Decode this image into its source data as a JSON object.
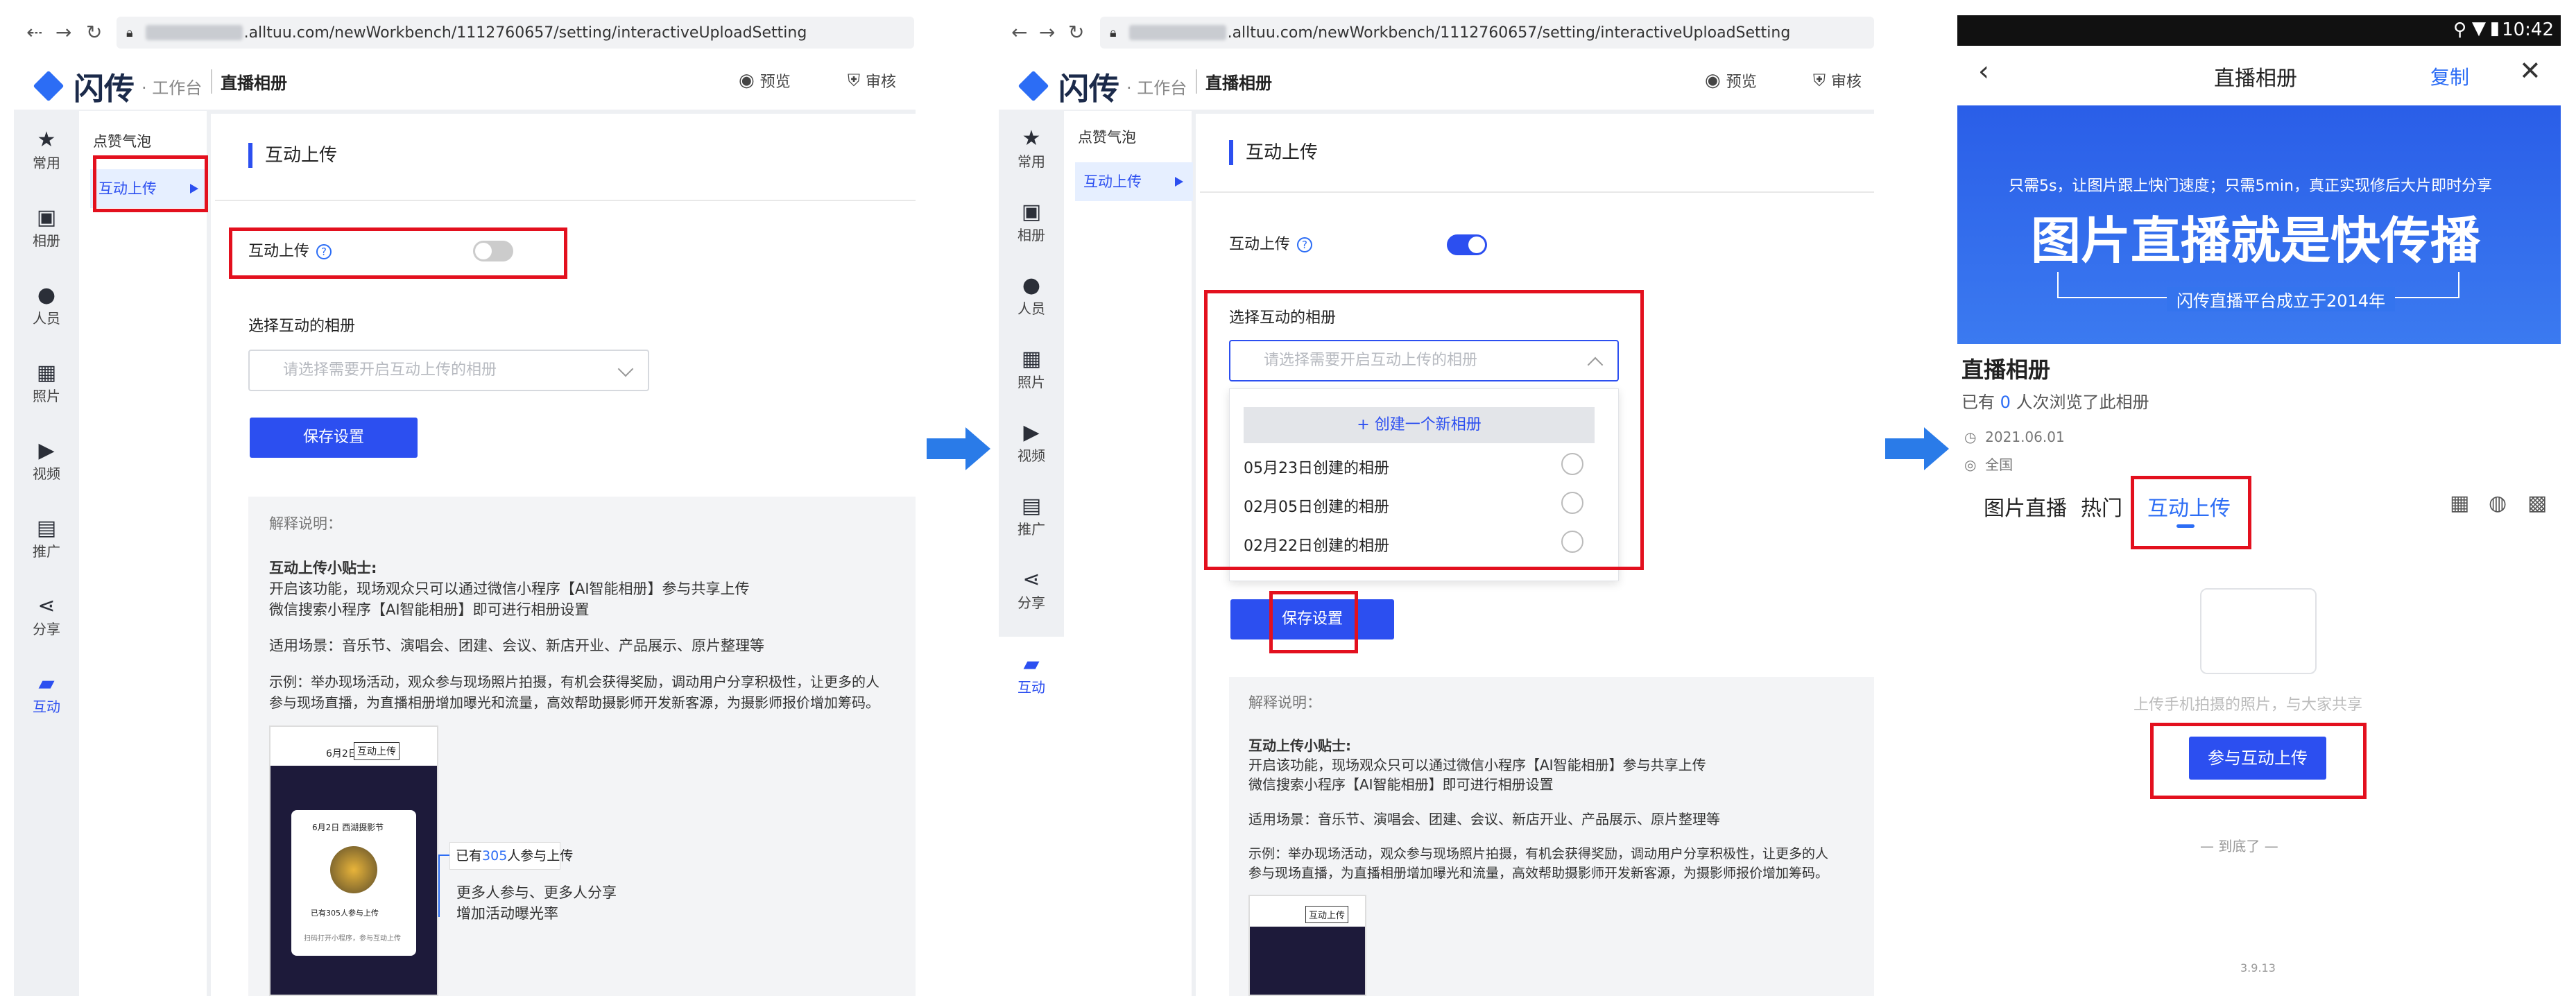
{
  "url_suffix": ".alltuu.com/newWorkbench/1112760657/setting/interactiveUploadSetting",
  "logo_text": "闪传",
  "workbench_label": "· 工作台",
  "app_title": "直播相册",
  "header": {
    "preview": "预览",
    "review": "审核"
  },
  "rail": [
    "常用",
    "相册",
    "人员",
    "照片",
    "视频",
    "推广",
    "分享",
    "互动"
  ],
  "submenu": [
    "点赞气泡",
    "互动上传"
  ],
  "section_title": "互动上传",
  "toggle_label": "互动上传",
  "select_label": "选择互动的相册",
  "select_placeholder": "请选择需要开启互动上传的相册",
  "save_label": "保存设置",
  "explain": {
    "heading": "解释说明：",
    "tip_title": "互动上传小贴士:",
    "tip_line1": "开启该功能，现场观众只可以通过微信小程序【AI智能相册】参与共享上传",
    "tip_line2": "微信搜索小程序【AI智能相册】即可进行相册设置",
    "scenes": "适用场景：音乐节、演唱会、团建、会议、新店开业、产品展示、原片整理等",
    "example1": "示例：举办现场活动，观众参与现场照片拍摄，有机会获得奖励，调动用户分享积极性，让更多的人",
    "example2": "参与现场直播，为直播相册增加曝光和流量，高效帮助摄影师开发新客源，为摄影师报价增加筹码。",
    "example2_alt1": "示例：举办现场活动，观众参与现场照片拍摄，有机会获得奖励，调动用户分享积极性，让更多的人",
    "example2_alt2": "参与现场直播，为直播相册增加曝光和流量，高效帮助摄影师开发新客源，为摄影师报价增加筹码。",
    "callout_title_pre": "已有",
    "callout_num": "305",
    "callout_title_post": "人参与上传",
    "callout_line1": "更多人参与、更多人分享",
    "callout_line2": "增加活动曝光率",
    "mini_date": "6月2日",
    "mini_tab": "互动上传",
    "mini_card_title": "6月2日 西湖摄影节",
    "mini_card_foot": "已有305人参与上传",
    "mini_card_bottom": "扫码打开小程序，参与互动上传"
  },
  "dropdown": {
    "create_new": "+ 创建一个新相册",
    "options": [
      "05月23日创建的相册",
      "02月05日创建的相册",
      "02月22日创建的相册"
    ]
  },
  "phone": {
    "time": "10:42",
    "nav_title": "直播相册",
    "copy": "复制",
    "banner_top": "只需5s，让图片跟上快门速度；只需5min，真正实现修后大片即时分享",
    "banner_main": "图片直播就是快传播",
    "banner_sub": "闪传直播平台成立于2014年",
    "album_title": "直播相册",
    "views_pre": "已有",
    "views_num": "0",
    "views_post": "人次浏览了此相册",
    "date": "2021.06.01",
    "location": "全国",
    "tabs": [
      "图片直播",
      "热门",
      "互动上传"
    ],
    "empty_text": "上传手机拍摄的照片，与大家共享",
    "join_button": "参与互动上传",
    "end_text": "— 到底了 —",
    "version": "3.9.13"
  },
  "colors": {
    "accent": "#2c4ff0",
    "highlight": "#e3101e",
    "arrow": "#2a7be8"
  }
}
